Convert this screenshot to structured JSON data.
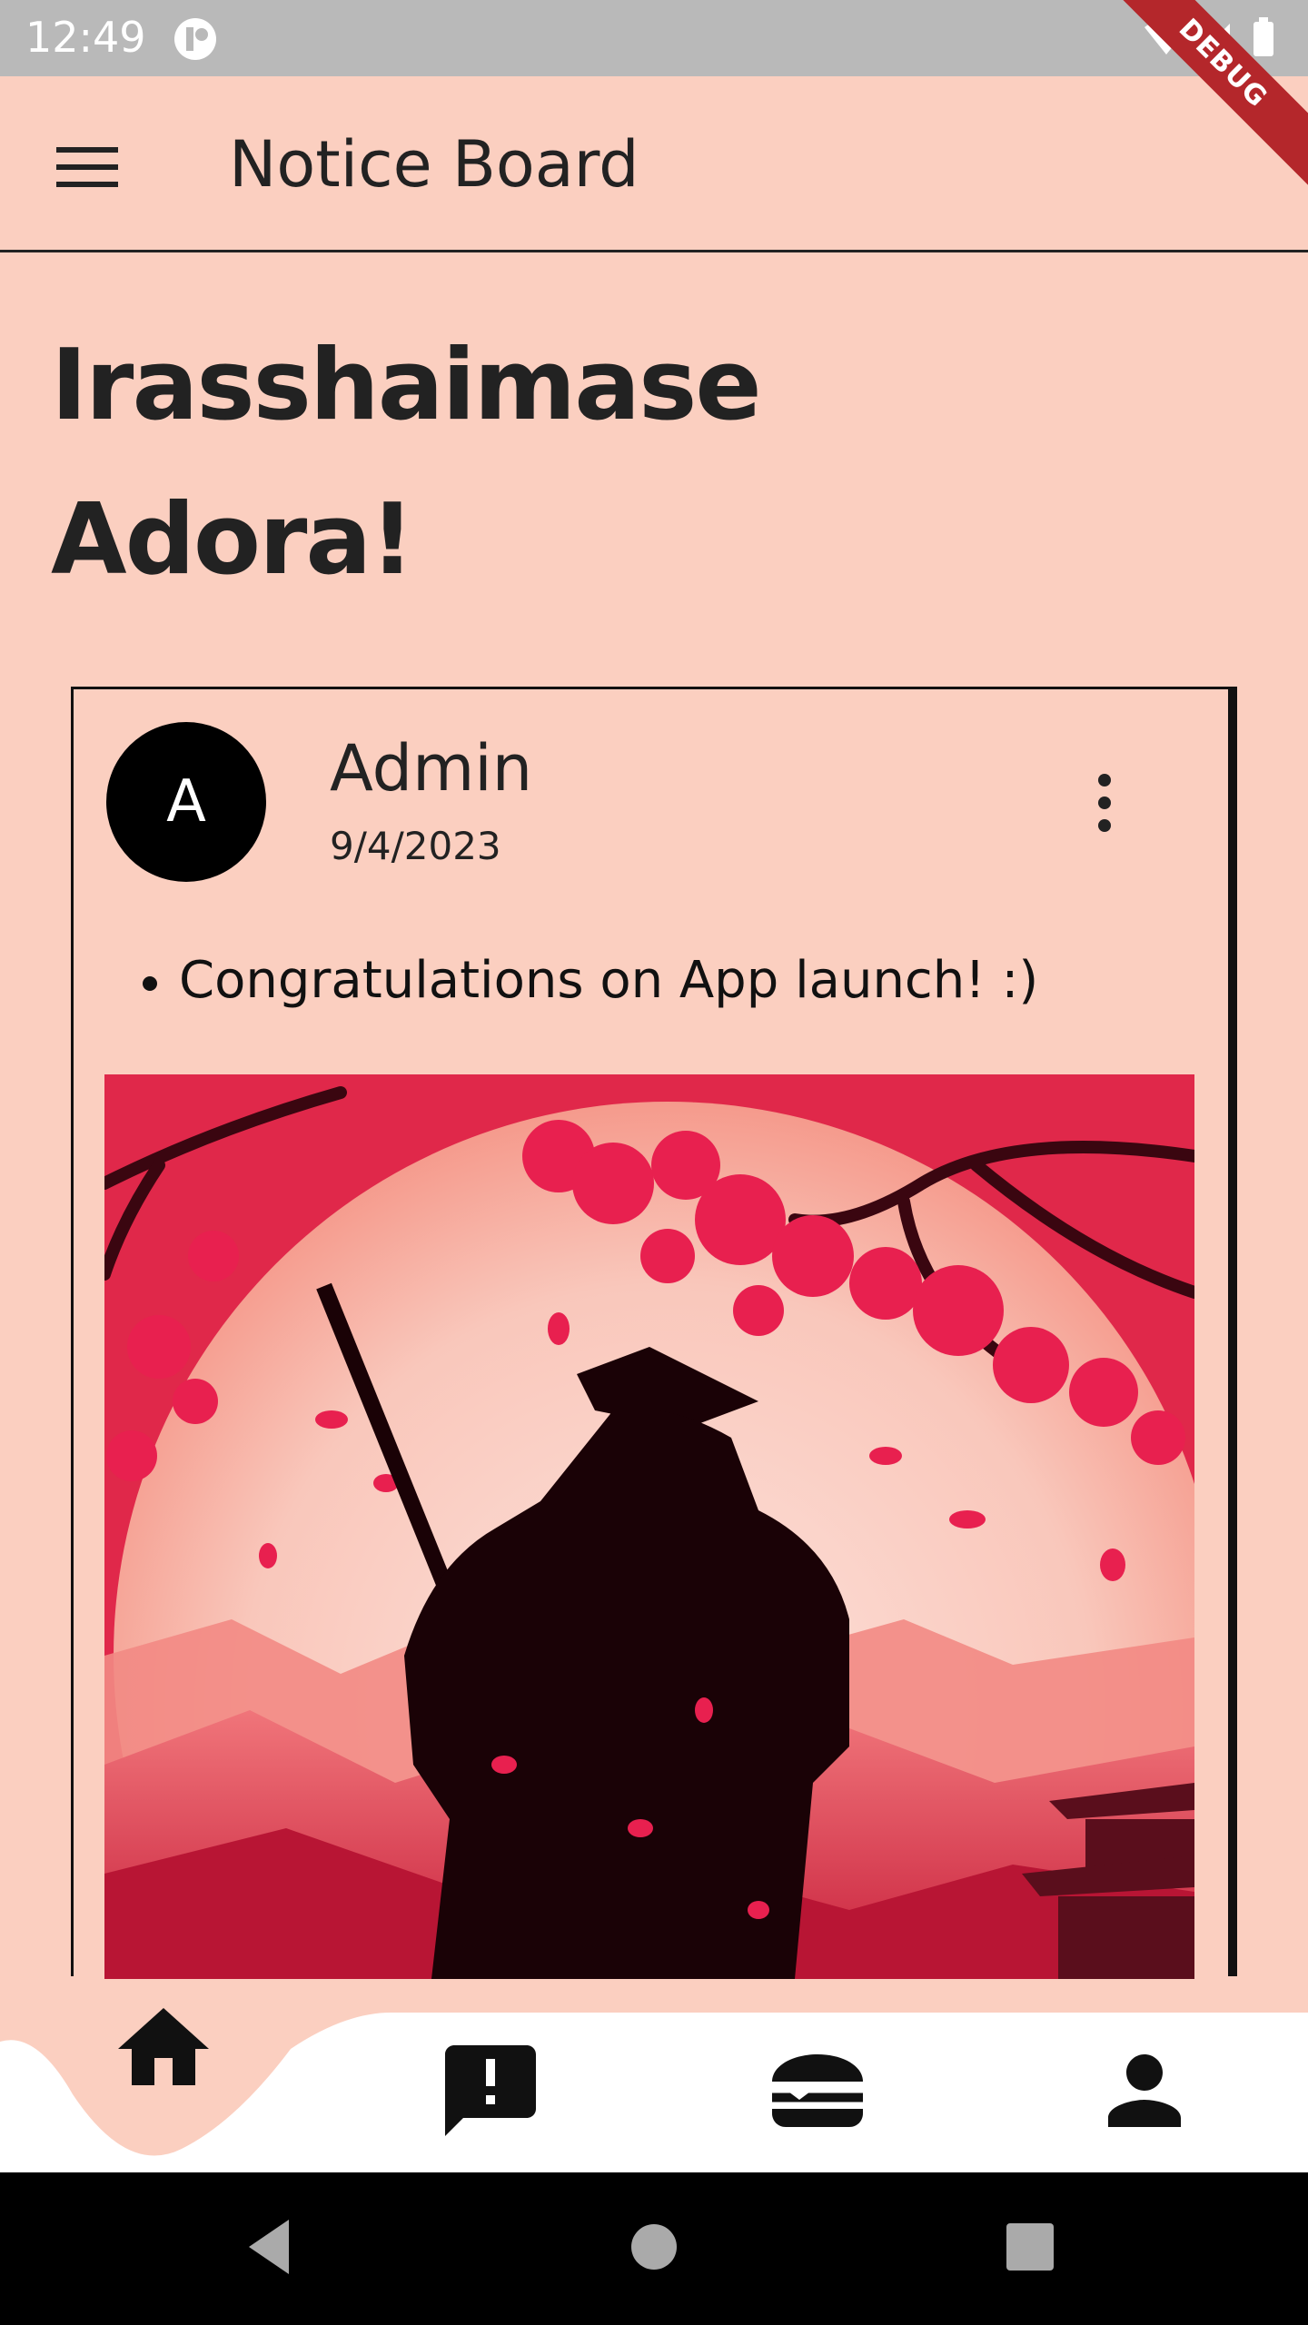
{
  "status_bar": {
    "time": "12:49",
    "debug_label": "DEBUG"
  },
  "app_bar": {
    "title": "Notice Board",
    "menu_icon": "menu-icon"
  },
  "greeting": {
    "line1": "Irasshaimase",
    "line2": "Adora!"
  },
  "post": {
    "avatar_letter": "A",
    "author": "Admin",
    "date": "9/4/2023",
    "bullet": "Congratulations on App launch! :)",
    "image_description_icon": "post-image"
  },
  "bottom_nav": {
    "items": [
      {
        "icon": "home-icon",
        "active": true
      },
      {
        "icon": "announcement-icon",
        "active": false
      },
      {
        "icon": "burger-icon",
        "active": false
      },
      {
        "icon": "person-icon",
        "active": false
      }
    ]
  },
  "colors": {
    "background": "#fbcfc0",
    "status_bar": "#b9b9b9",
    "nav_bar": "#ffffff",
    "system_nav": "#000000",
    "debug_banner": "#b4272b"
  }
}
